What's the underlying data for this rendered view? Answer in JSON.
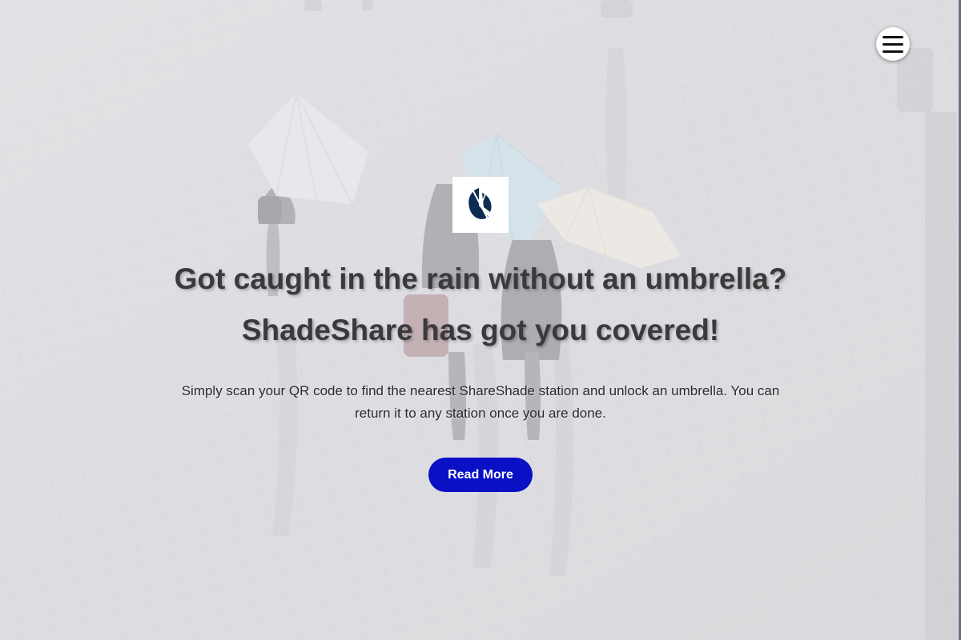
{
  "header": {
    "menu_icon": "hamburger-menu-icon"
  },
  "hero": {
    "logo_icon": "umbrella-logo-icon",
    "headline_line1": "Got caught in the rain without an umbrella?",
    "headline_line2": "ShadeShare has got you covered!",
    "description": "Simply scan your QR code to find the nearest ShareShade station and unlock an umbrella. You can return it to any station once you are done.",
    "cta_label": "Read More"
  },
  "colors": {
    "cta_background": "#0a10c4",
    "logo_mark": "#0d2c52",
    "headline_text": "#3a3a3c"
  }
}
